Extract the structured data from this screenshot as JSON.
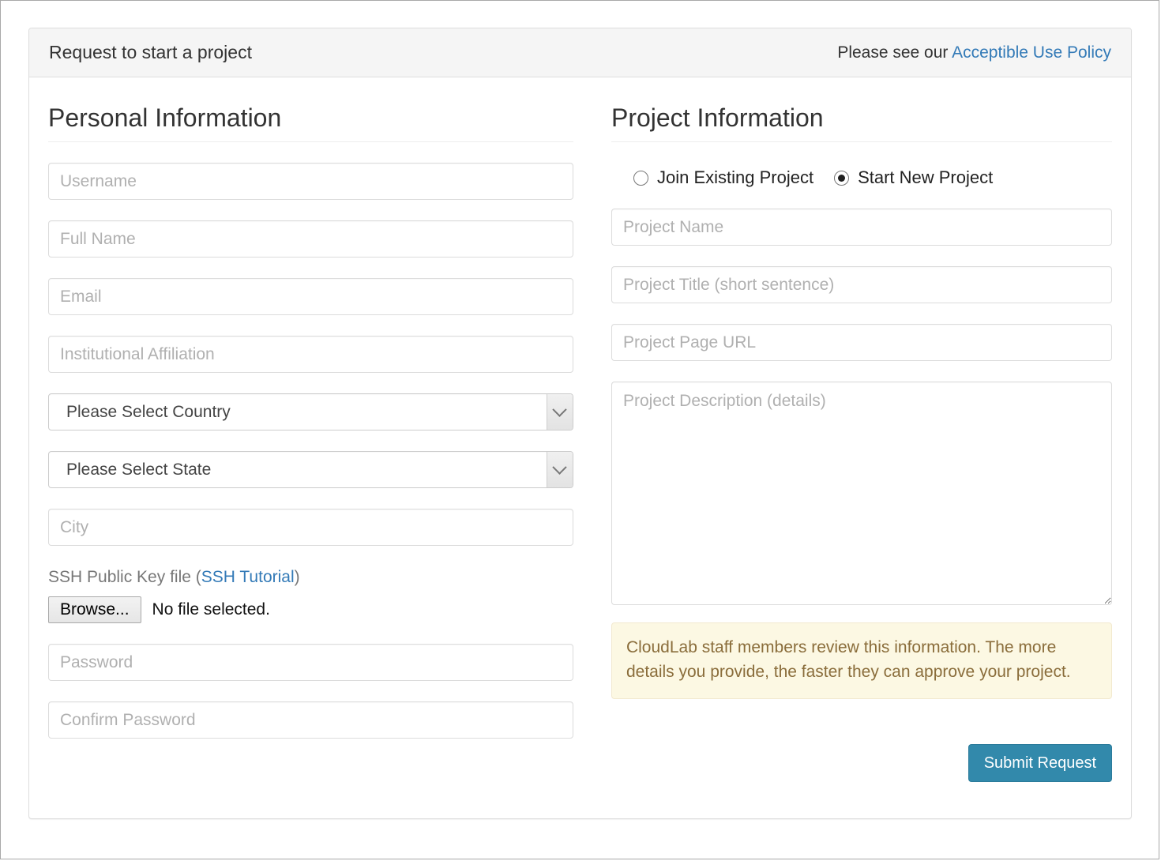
{
  "panel": {
    "title": "Request to start a project",
    "header_note_prefix": "Please see our ",
    "header_link": "Acceptible Use Policy"
  },
  "personal": {
    "section_title": "Personal Information",
    "username_placeholder": "Username",
    "username_value": "",
    "fullname_placeholder": "Full Name",
    "fullname_value": "",
    "email_placeholder": "Email",
    "email_value": "",
    "affiliation_placeholder": "Institutional Affiliation",
    "affiliation_value": "",
    "country_selected": "Please Select Country",
    "state_selected": "Please Select State",
    "city_placeholder": "City",
    "city_value": "",
    "ssh_label_prefix": "SSH Public Key file (",
    "ssh_link": "SSH Tutorial",
    "ssh_label_suffix": ")",
    "browse_label": "Browse...",
    "file_status": "No file selected.",
    "password_placeholder": "Password",
    "password_value": "",
    "confirm_password_placeholder": "Confirm Password",
    "confirm_password_value": ""
  },
  "project": {
    "section_title": "Project Information",
    "radio_join_label": "Join Existing Project",
    "radio_new_label": "Start New Project",
    "selected_radio": "Start New Project",
    "name_placeholder": "Project Name",
    "name_value": "",
    "title_placeholder": "Project Title (short sentence)",
    "title_value": "",
    "url_placeholder": "Project Page URL",
    "url_value": "",
    "description_placeholder": "Project Description (details)",
    "description_value": "",
    "notice": "CloudLab staff members review this information. The more details you provide, the faster they can approve your project.",
    "submit_label": "Submit Request"
  },
  "colors": {
    "accent": "#3289ab",
    "link": "#337ab7",
    "notice_bg": "#fcf8e3",
    "notice_text": "#8a6d3b",
    "panel_header_bg": "#f5f5f5",
    "border": "#dddddd"
  }
}
